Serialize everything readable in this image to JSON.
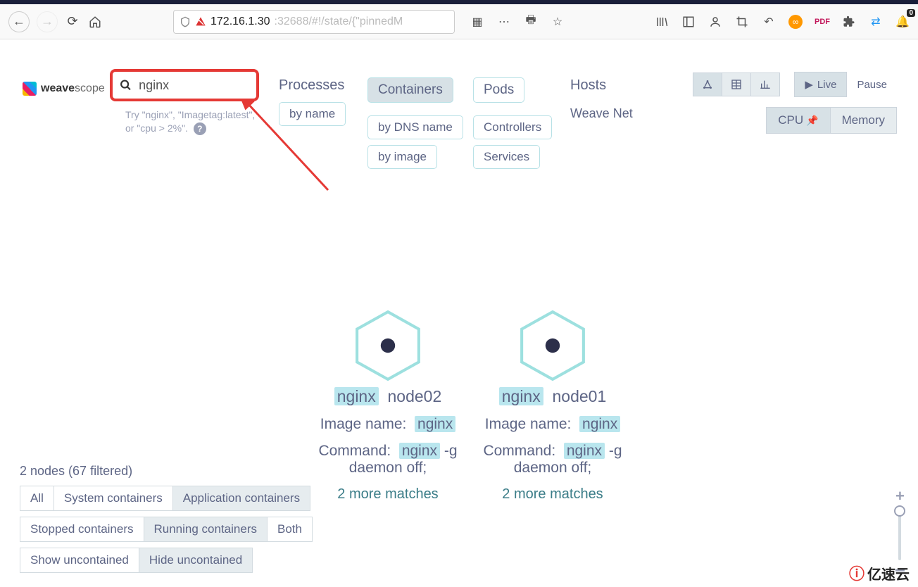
{
  "browser": {
    "url_gray": "172.16.1.30",
    "url_suffix": ":32688/#!/state/{\"pinnedM",
    "notif_count": "0"
  },
  "logo": {
    "thin": "weave",
    "bold": "scope"
  },
  "search": {
    "value": "nginx",
    "hint": "Try \"nginx\", \"Imagetag:latest\", or \"cpu > 2%\"."
  },
  "nav": {
    "processes": "Processes",
    "containers": "Containers",
    "pods": "Pods",
    "hosts": "Hosts",
    "weavenet": "Weave Net",
    "by_name": "by name",
    "by_dns": "by DNS name",
    "by_image": "by image",
    "controllers": "Controllers",
    "services": "Services"
  },
  "controls": {
    "live": "Live",
    "pause": "Pause",
    "cpu": "CPU",
    "memory": "Memory"
  },
  "nodes": [
    {
      "name": "nginx",
      "host": "node02",
      "image_label": "Image name:",
      "image": "nginx",
      "cmd_label": "Command:",
      "cmd_hl": "nginx",
      "cmd_rest": " -g daemon off;",
      "more": "2 more matches"
    },
    {
      "name": "nginx",
      "host": "node01",
      "image_label": "Image name:",
      "image": "nginx",
      "cmd_label": "Command:",
      "cmd_hl": "nginx",
      "cmd_rest": " -g daemon off;",
      "more": "2 more matches"
    }
  ],
  "footer": {
    "count": "2 nodes (67 filtered)",
    "filters1": [
      "All",
      "System containers",
      "Application containers"
    ],
    "filters1_active": 2,
    "filters2": [
      "Stopped containers",
      "Running containers",
      "Both"
    ],
    "filters2_active": 1,
    "filters3": [
      "Show uncontained",
      "Hide uncontained"
    ],
    "filters3_active": 1
  },
  "watermark": "亿速云"
}
